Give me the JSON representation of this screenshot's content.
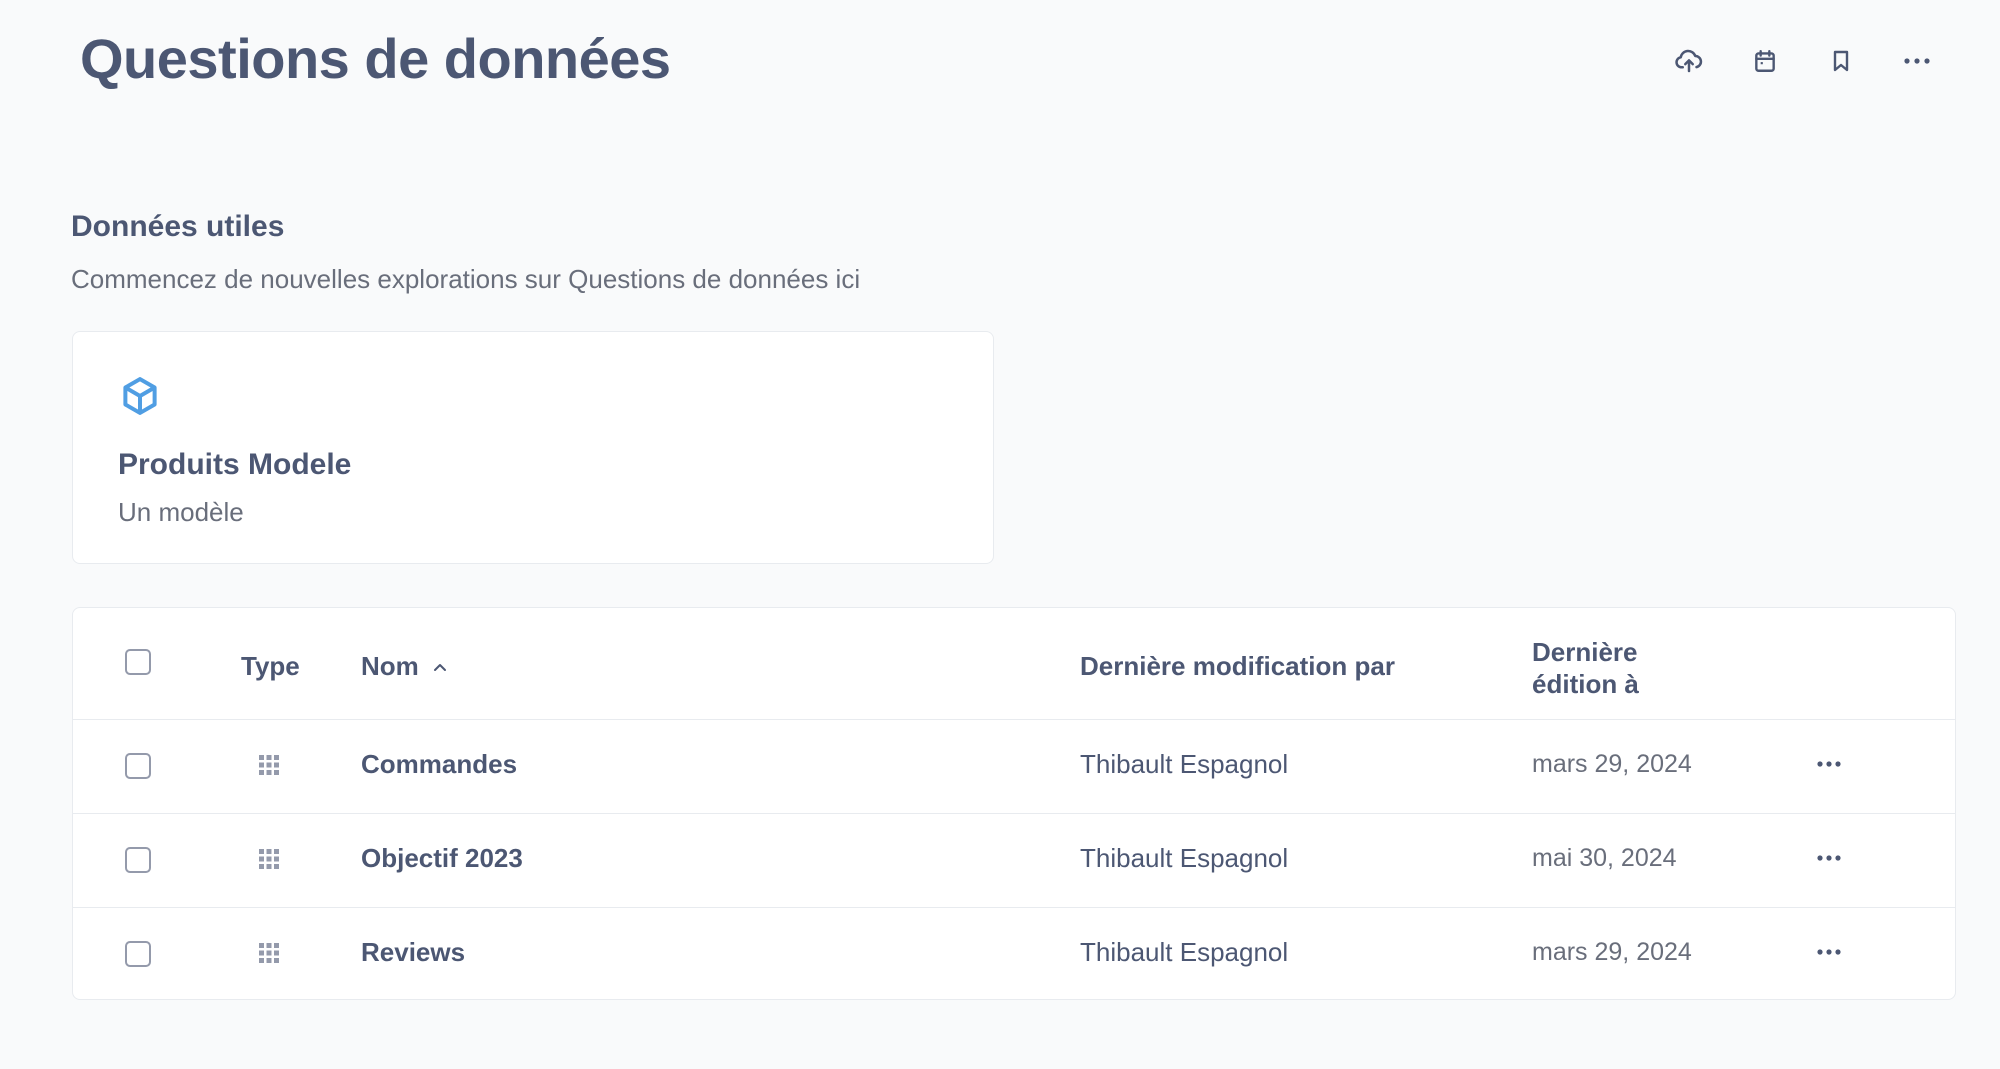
{
  "header": {
    "title": "Questions de données",
    "actions": [
      {
        "name": "upload-icon"
      },
      {
        "name": "calendar-icon"
      },
      {
        "name": "bookmark-icon"
      },
      {
        "name": "more-icon"
      }
    ]
  },
  "section": {
    "title": "Données utiles",
    "description": "Commencez de nouvelles explorations sur Questions de données ici"
  },
  "model_card": {
    "icon": "cube-icon",
    "title": "Produits Modele",
    "subtitle": "Un modèle",
    "icon_color": "#509ee3"
  },
  "table": {
    "headers": {
      "type": "Type",
      "name": "Nom",
      "modified_by": "Dernière modification par",
      "edited_at_line1": "Dernière",
      "edited_at_line2": "édition à"
    },
    "rows": [
      {
        "type_icon": "grid-icon",
        "name": "Commandes",
        "modified_by": "Thibault Espagnol",
        "edited_at": "mars 29, 2024"
      },
      {
        "type_icon": "grid-icon",
        "name": "Objectif 2023",
        "modified_by": "Thibault Espagnol",
        "edited_at": "mai 30, 2024"
      },
      {
        "type_icon": "grid-icon",
        "name": "Reviews",
        "modified_by": "Thibault Espagnol",
        "edited_at": "mars 29, 2024"
      }
    ]
  },
  "colors": {
    "text": "#4c5773",
    "muted": "#696e7b",
    "accent": "#509ee3",
    "border": "#e8ebef",
    "background": "#f9fafb"
  }
}
